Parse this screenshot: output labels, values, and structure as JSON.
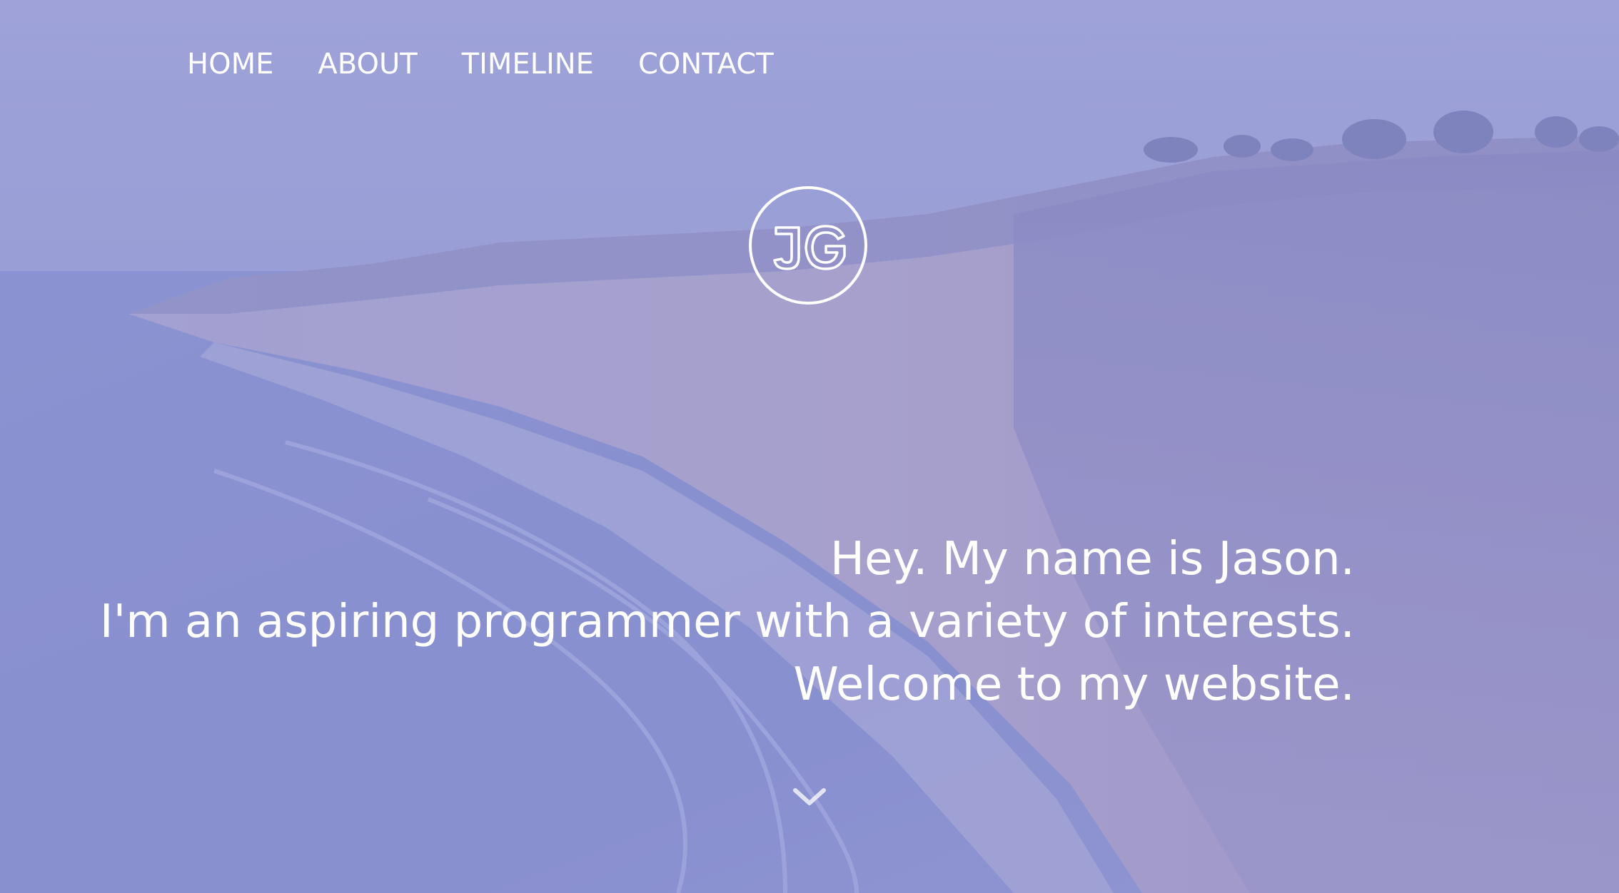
{
  "nav": {
    "items": [
      {
        "label": "HOME"
      },
      {
        "label": "ABOUT"
      },
      {
        "label": "TIMELINE"
      },
      {
        "label": "CONTACT"
      }
    ]
  },
  "logo": {
    "text": "JG",
    "icon": "jg-monogram-icon"
  },
  "intro": {
    "line1": "Hey. My name is Jason.",
    "line2": "I'm an aspiring programmer with a variety of interests.",
    "line3": "Welcome to my website."
  },
  "scroll": {
    "icon": "chevron-down-icon"
  },
  "colors": {
    "text": "#ffffff",
    "tint": "#8287d7"
  }
}
